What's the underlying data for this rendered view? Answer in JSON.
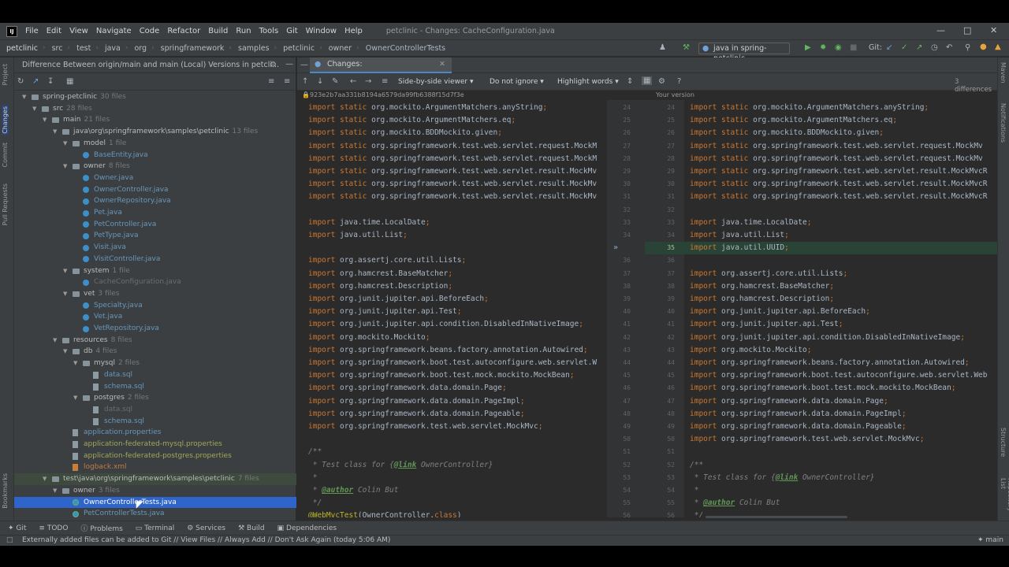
{
  "app": {
    "menu": [
      "File",
      "Edit",
      "View",
      "Navigate",
      "Code",
      "Refactor",
      "Build",
      "Run",
      "Tools",
      "Git",
      "Window",
      "Help"
    ],
    "window_title": "petclinic - Changes: CacheConfiguration.java",
    "logo": "IJ"
  },
  "breadcrumb": [
    "petclinic",
    "src",
    "test",
    "java",
    "org",
    "springframework",
    "samples",
    "petclinic",
    "owner",
    "OwnerControllerTests"
  ],
  "toolbar": {
    "run_config": "java in spring-petclinic",
    "git_label": "Git:"
  },
  "left_stripe": [
    "Project",
    "Changes",
    "Commit",
    "Pull Requests",
    "Bookmarks"
  ],
  "right_stripe": [
    "Maven",
    "Notifications",
    "Structure",
    "Repository List"
  ],
  "changes_panel": {
    "title": "Difference Between origin/main and main (Local) Versions in petcli..."
  },
  "tree": [
    {
      "label": "spring-petclinic",
      "count": "30 files",
      "depth": 0,
      "type": "folder",
      "cls": "c-dir",
      "open": true
    },
    {
      "label": "src",
      "count": "28 files",
      "depth": 1,
      "type": "folder",
      "cls": "c-dir",
      "open": true
    },
    {
      "label": "main",
      "count": "21 files",
      "depth": 2,
      "type": "folder",
      "cls": "c-dir",
      "open": true
    },
    {
      "label": "java\\org\\springframework\\samples\\petclinic",
      "count": "13 files",
      "depth": 3,
      "type": "folder",
      "cls": "c-dir",
      "open": true
    },
    {
      "label": "model",
      "count": "1 file",
      "depth": 4,
      "type": "folder",
      "cls": "c-dir",
      "open": true
    },
    {
      "label": "BaseEntity.java",
      "count": "",
      "depth": 5,
      "type": "java",
      "cls": "c-mod"
    },
    {
      "label": "owner",
      "count": "8 files",
      "depth": 4,
      "type": "folder",
      "cls": "c-dir",
      "open": true
    },
    {
      "label": "Owner.java",
      "count": "",
      "depth": 5,
      "type": "java",
      "cls": "c-mod"
    },
    {
      "label": "OwnerController.java",
      "count": "",
      "depth": 5,
      "type": "java",
      "cls": "c-mod"
    },
    {
      "label": "OwnerRepository.java",
      "count": "",
      "depth": 5,
      "type": "java",
      "cls": "c-mod"
    },
    {
      "label": "Pet.java",
      "count": "",
      "depth": 5,
      "type": "java",
      "cls": "c-mod"
    },
    {
      "label": "PetController.java",
      "count": "",
      "depth": 5,
      "type": "java",
      "cls": "c-mod"
    },
    {
      "label": "PetType.java",
      "count": "",
      "depth": 5,
      "type": "java",
      "cls": "c-mod"
    },
    {
      "label": "Visit.java",
      "count": "",
      "depth": 5,
      "type": "java",
      "cls": "c-mod"
    },
    {
      "label": "VisitController.java",
      "count": "",
      "depth": 5,
      "type": "java",
      "cls": "c-mod"
    },
    {
      "label": "system",
      "count": "1 file",
      "depth": 4,
      "type": "folder",
      "cls": "c-dir",
      "open": true
    },
    {
      "label": "CacheConfiguration.java",
      "count": "",
      "depth": 5,
      "type": "java",
      "cls": "c-del"
    },
    {
      "label": "vet",
      "count": "3 files",
      "depth": 4,
      "type": "folder",
      "cls": "c-dir",
      "open": true
    },
    {
      "label": "Specialty.java",
      "count": "",
      "depth": 5,
      "type": "java",
      "cls": "c-mod"
    },
    {
      "label": "Vet.java",
      "count": "",
      "depth": 5,
      "type": "java",
      "cls": "c-mod"
    },
    {
      "label": "VetRepository.java",
      "count": "",
      "depth": 5,
      "type": "java",
      "cls": "c-mod"
    },
    {
      "label": "resources",
      "count": "8 files",
      "depth": 3,
      "type": "folder",
      "cls": "c-dir",
      "open": true
    },
    {
      "label": "db",
      "count": "4 files",
      "depth": 4,
      "type": "folder",
      "cls": "c-dir",
      "open": true
    },
    {
      "label": "mysql",
      "count": "2 files",
      "depth": 5,
      "type": "folder",
      "cls": "c-dir",
      "open": true
    },
    {
      "label": "data.sql",
      "count": "",
      "depth": 6,
      "type": "file",
      "cls": "c-mod"
    },
    {
      "label": "schema.sql",
      "count": "",
      "depth": 6,
      "type": "file",
      "cls": "c-mod"
    },
    {
      "label": "postgres",
      "count": "2 files",
      "depth": 5,
      "type": "folder",
      "cls": "c-dir",
      "open": true
    },
    {
      "label": "data.sql",
      "count": "",
      "depth": 6,
      "type": "file",
      "cls": "c-del"
    },
    {
      "label": "schema.sql",
      "count": "",
      "depth": 6,
      "type": "file",
      "cls": "c-mod"
    },
    {
      "label": "application.properties",
      "count": "",
      "depth": 4,
      "type": "file",
      "cls": "c-mod"
    },
    {
      "label": "application-federated-mysql.properties",
      "count": "",
      "depth": 4,
      "type": "file",
      "cls": "c-add2"
    },
    {
      "label": "application-federated-postgres.properties",
      "count": "",
      "depth": 4,
      "type": "file",
      "cls": "c-add2"
    },
    {
      "label": "logback.xml",
      "count": "",
      "depth": 4,
      "type": "xml",
      "cls": "c-unv"
    },
    {
      "label": "test\\java\\org\\springframework\\samples\\petclinic",
      "count": "7 files",
      "depth": 2,
      "type": "folder",
      "cls": "c-dir",
      "open": true,
      "hl": true
    },
    {
      "label": "owner",
      "count": "3 files",
      "depth": 3,
      "type": "folder",
      "cls": "c-dir",
      "open": true
    },
    {
      "label": "OwnerControllerTests.java",
      "count": "",
      "depth": 4,
      "type": "test",
      "cls": "c-sel",
      "sel": true
    },
    {
      "label": "PetControllerTests.java",
      "count": "",
      "depth": 4,
      "type": "test",
      "cls": "c-mod"
    }
  ],
  "editor": {
    "tab_label": "Changes: OwnerControllerTests.java",
    "viewer_mode": "Side-by-side viewer",
    "ignore_mode": "Do not ignore",
    "highlight_mode": "Highlight words",
    "differences": "3 differences",
    "left_revision": "923e2b7aa331b8194a6579da99fb6388f15d7f3e",
    "right_revision": "Your version"
  },
  "code_left": [
    "import static org.mockito.ArgumentMatchers.anyString;",
    "import static org.mockito.ArgumentMatchers.eq;",
    "import static org.mockito.BDDMockito.given;",
    "import static org.springframework.test.web.servlet.request.MockM",
    "import static org.springframework.test.web.servlet.request.MockM",
    "import static org.springframework.test.web.servlet.result.MockMv",
    "import static org.springframework.test.web.servlet.result.MockMv",
    "import static org.springframework.test.web.servlet.result.MockMv",
    "",
    "import java.time.LocalDate;",
    "import java.util.List;",
    "",
    "import org.assertj.core.util.Lists;",
    "import org.hamcrest.BaseMatcher;",
    "import org.hamcrest.Description;",
    "import org.junit.jupiter.api.BeforeEach;",
    "import org.junit.jupiter.api.Test;",
    "import org.junit.jupiter.api.condition.DisabledInNativeImage;",
    "import org.mockito.Mockito;",
    "import org.springframework.beans.factory.annotation.Autowired;",
    "import org.springframework.boot.test.autoconfigure.web.servlet.W",
    "import org.springframework.boot.test.mock.mockito.MockBean;",
    "import org.springframework.data.domain.Page;",
    "import org.springframework.data.domain.PageImpl;",
    "import org.springframework.data.domain.Pageable;",
    "import org.springframework.test.web.servlet.MockMvc;",
    "",
    "/**",
    " * Test class for {@link OwnerController}",
    " *",
    " * @author Colin But",
    " */",
    "@WebMvcTest(OwnerController.class)"
  ],
  "code_right": [
    "import static org.mockito.ArgumentMatchers.anyString;",
    "import static org.mockito.ArgumentMatchers.eq;",
    "import static org.mockito.BDDMockito.given;",
    "import static org.springframework.test.web.servlet.request.MockMv",
    "import static org.springframework.test.web.servlet.request.MockMv",
    "import static org.springframework.test.web.servlet.result.MockMvcR",
    "import static org.springframework.test.web.servlet.result.MockMvcR",
    "import static org.springframework.test.web.servlet.result.MockMvcR",
    "",
    "import java.time.LocalDate;",
    "import java.util.List;",
    "import java.util.UUID;",
    "",
    "import org.assertj.core.util.Lists;",
    "import org.hamcrest.BaseMatcher;",
    "import org.hamcrest.Description;",
    "import org.junit.jupiter.api.BeforeEach;",
    "import org.junit.jupiter.api.Test;",
    "import org.junit.jupiter.api.condition.DisabledInNativeImage;",
    "import org.mockito.Mockito;",
    "import org.springframework.beans.factory.annotation.Autowired;",
    "import org.springframework.boot.test.autoconfigure.web.servlet.Web",
    "import org.springframework.boot.test.mock.mockito.MockBean;",
    "import org.springframework.data.domain.Page;",
    "import org.springframework.data.domain.PageImpl;",
    "import org.springframework.data.domain.Pageable;",
    "import org.springframework.test.web.servlet.MockMvc;",
    "",
    "/**",
    " * Test class for {@link OwnerController}",
    " *",
    " * @author Colin But",
    " */"
  ],
  "gutter_left": [
    "24",
    "25",
    "26",
    "27",
    "28",
    "29",
    "30",
    "31",
    "32",
    "33",
    "34",
    "",
    "36",
    "37",
    "38",
    "39",
    "40",
    "41",
    "42",
    "43",
    "44",
    "45",
    "46",
    "47",
    "48",
    "49",
    "50",
    "51",
    "52",
    "53",
    "54",
    "55",
    "56"
  ],
  "gutter_right": [
    "24",
    "25",
    "26",
    "27",
    "28",
    "29",
    "30",
    "31",
    "32",
    "33",
    "34",
    "35",
    "36",
    "37",
    "38",
    "39",
    "40",
    "41",
    "42",
    "43",
    "44",
    "45",
    "46",
    "47",
    "48",
    "49",
    "50",
    "51",
    "52",
    "53",
    "54",
    "55",
    "56"
  ],
  "bottom_tabs": [
    "Git",
    "TODO",
    "Problems",
    "Terminal",
    "Services",
    "Build",
    "Dependencies"
  ],
  "status": {
    "message": "Externally added files can be added to Git // View Files // Always Add // Don't Ask Again (today 5:06 AM)",
    "branch": "main"
  },
  "colors": {
    "accent": "#2f65ca",
    "added_bg": "#294436",
    "keyword": "#cc7832"
  }
}
